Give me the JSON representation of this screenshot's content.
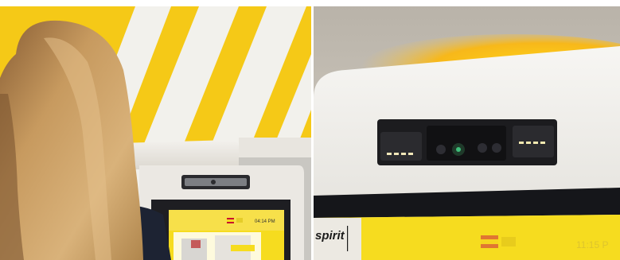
{
  "left_photo": {
    "kiosk_screen": {
      "clock": "04:14 PM"
    }
  },
  "right_photo": {
    "brand": "spirit",
    "blurred_time": "11:15 P"
  },
  "colors": {
    "brand_yellow": "#f6dc1f",
    "wall_stripe_white": "#f2f1ec",
    "kiosk_body": "#eceae6",
    "kiosk_bezel": "#1e1e22",
    "hair": "#b98c52"
  }
}
